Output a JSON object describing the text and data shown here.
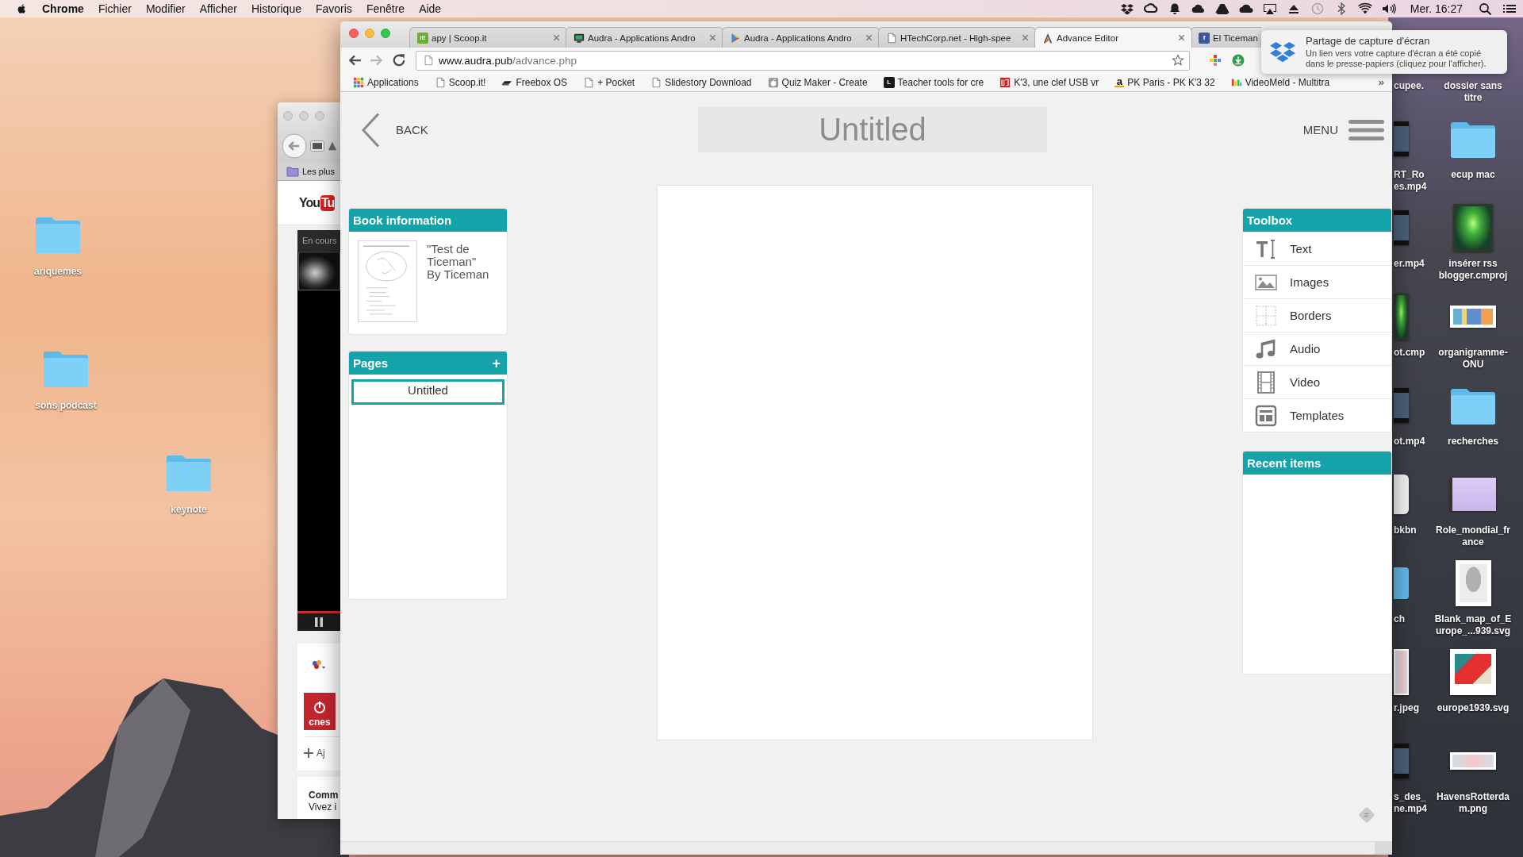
{
  "menu_bar": {
    "app": "Chrome",
    "menus": [
      "Fichier",
      "Modifier",
      "Afficher",
      "Historique",
      "Favoris",
      "Fenêtre",
      "Aide"
    ],
    "clock": "Mer. 16:27"
  },
  "desktop": {
    "left_icons": [
      {
        "label": "ariquemes",
        "kind": "folder"
      },
      {
        "label": "sons podcast",
        "kind": "folder"
      },
      {
        "label": "keynote",
        "kind": "folder"
      }
    ],
    "cut_off_icons": [
      {
        "label": "cupee.",
        "kind": "none"
      },
      {
        "label": "RT_Ro es.mp4",
        "kind": "video"
      },
      {
        "label": "er.mp4",
        "kind": "video"
      },
      {
        "label": "ot.cmp",
        "kind": "project"
      },
      {
        "label": "ot.mp4",
        "kind": "video"
      },
      {
        "label": "bkbn",
        "kind": "document"
      },
      {
        "label": "ch",
        "kind": "folder"
      },
      {
        "label": "r.jpeg",
        "kind": "image"
      },
      {
        "label": "s_des_ ne.mp4",
        "kind": "video"
      }
    ],
    "right_icons": [
      {
        "label": "dossier sans titre",
        "kind": "none"
      },
      {
        "label": "ecup mac",
        "kind": "folder"
      },
      {
        "label": "insérer rss blogger.cmproj",
        "kind": "project"
      },
      {
        "label": "organigramme-ONU",
        "kind": "chart"
      },
      {
        "label": "recherches",
        "kind": "folder"
      },
      {
        "label": "Role_mondial_france",
        "kind": "slides"
      },
      {
        "label": "Blank_map_of_Europe_...939.svg",
        "kind": "map"
      },
      {
        "label": "europe1939.svg",
        "kind": "mapcolor"
      },
      {
        "label": "HavensRotterdam.png",
        "kind": "image"
      }
    ]
  },
  "background_window": {
    "bookmark": "Les plus",
    "logo_left": "You",
    "logo_right": "Tu",
    "video_label": "En cours",
    "channel_logo": "cnes",
    "add_link": "Aj",
    "section_title": "Comm",
    "section_text": "Vivez i"
  },
  "browser": {
    "tabs": [
      {
        "title": "apy | Scoop.it",
        "kind": "leaf",
        "icon_text": "it!",
        "selected": false
      },
      {
        "title": "Audra - Applications Andro",
        "kind": "monitor",
        "selected": false
      },
      {
        "title": "Audra - Applications Andro",
        "kind": "play",
        "selected": false
      },
      {
        "title": "HTechCorp.net - High-spee",
        "kind": "page",
        "selected": false
      },
      {
        "title": "Advance Editor",
        "kind": "peak",
        "selected": true
      },
      {
        "title": "El Ticeman",
        "kind": "social",
        "icon_text": "f",
        "selected": false
      }
    ],
    "url": {
      "host": "www.audra.pub",
      "path": "/advance.php"
    },
    "bookmarks": [
      {
        "label": "Applications",
        "kind": "apps"
      },
      {
        "label": "Scoop.it!",
        "kind": "page"
      },
      {
        "label": "Freebox OS",
        "kind": "device"
      },
      {
        "label": "+ Pocket",
        "kind": "page"
      },
      {
        "label": "Slidestory Download",
        "kind": "page"
      },
      {
        "label": "Quiz Maker - Create",
        "kind": "apple"
      },
      {
        "label": "Teacher tools for cre",
        "kind": "ink",
        "icon_text": "L"
      },
      {
        "label": "K'3, une clef USB vr",
        "kind": "logo"
      },
      {
        "label": "PK Paris - PK K'3 32",
        "kind": "glyph",
        "icon_text": "a"
      },
      {
        "label": "VideoMeld - Multitra",
        "kind": "bars"
      }
    ],
    "more_bookmarks": "»"
  },
  "editor": {
    "back_label": "BACK",
    "title": "Untitled",
    "menu_label": "MENU",
    "book_info": {
      "heading": "Book information",
      "title": "\"Test de Ticeman\"",
      "byline": "By Ticeman"
    },
    "pages": {
      "heading": "Pages",
      "add_label": "+",
      "items": [
        {
          "title": "Untitled",
          "selected": true
        }
      ]
    },
    "toolbox": {
      "heading": "Toolbox",
      "items": [
        {
          "label": "Text",
          "kind": "text"
        },
        {
          "label": "Images",
          "kind": "images"
        },
        {
          "label": "Borders",
          "kind": "borders"
        },
        {
          "label": "Audio",
          "kind": "audio"
        },
        {
          "label": "Video",
          "kind": "video"
        },
        {
          "label": "Templates",
          "kind": "templates"
        }
      ]
    },
    "recent": {
      "heading": "Recent items"
    }
  },
  "notification": {
    "title": "Partage de capture d'écran",
    "body": "Un lien vers votre capture d'écran a été copié dans le presse-papiers (cliquez pour l'afficher)."
  }
}
